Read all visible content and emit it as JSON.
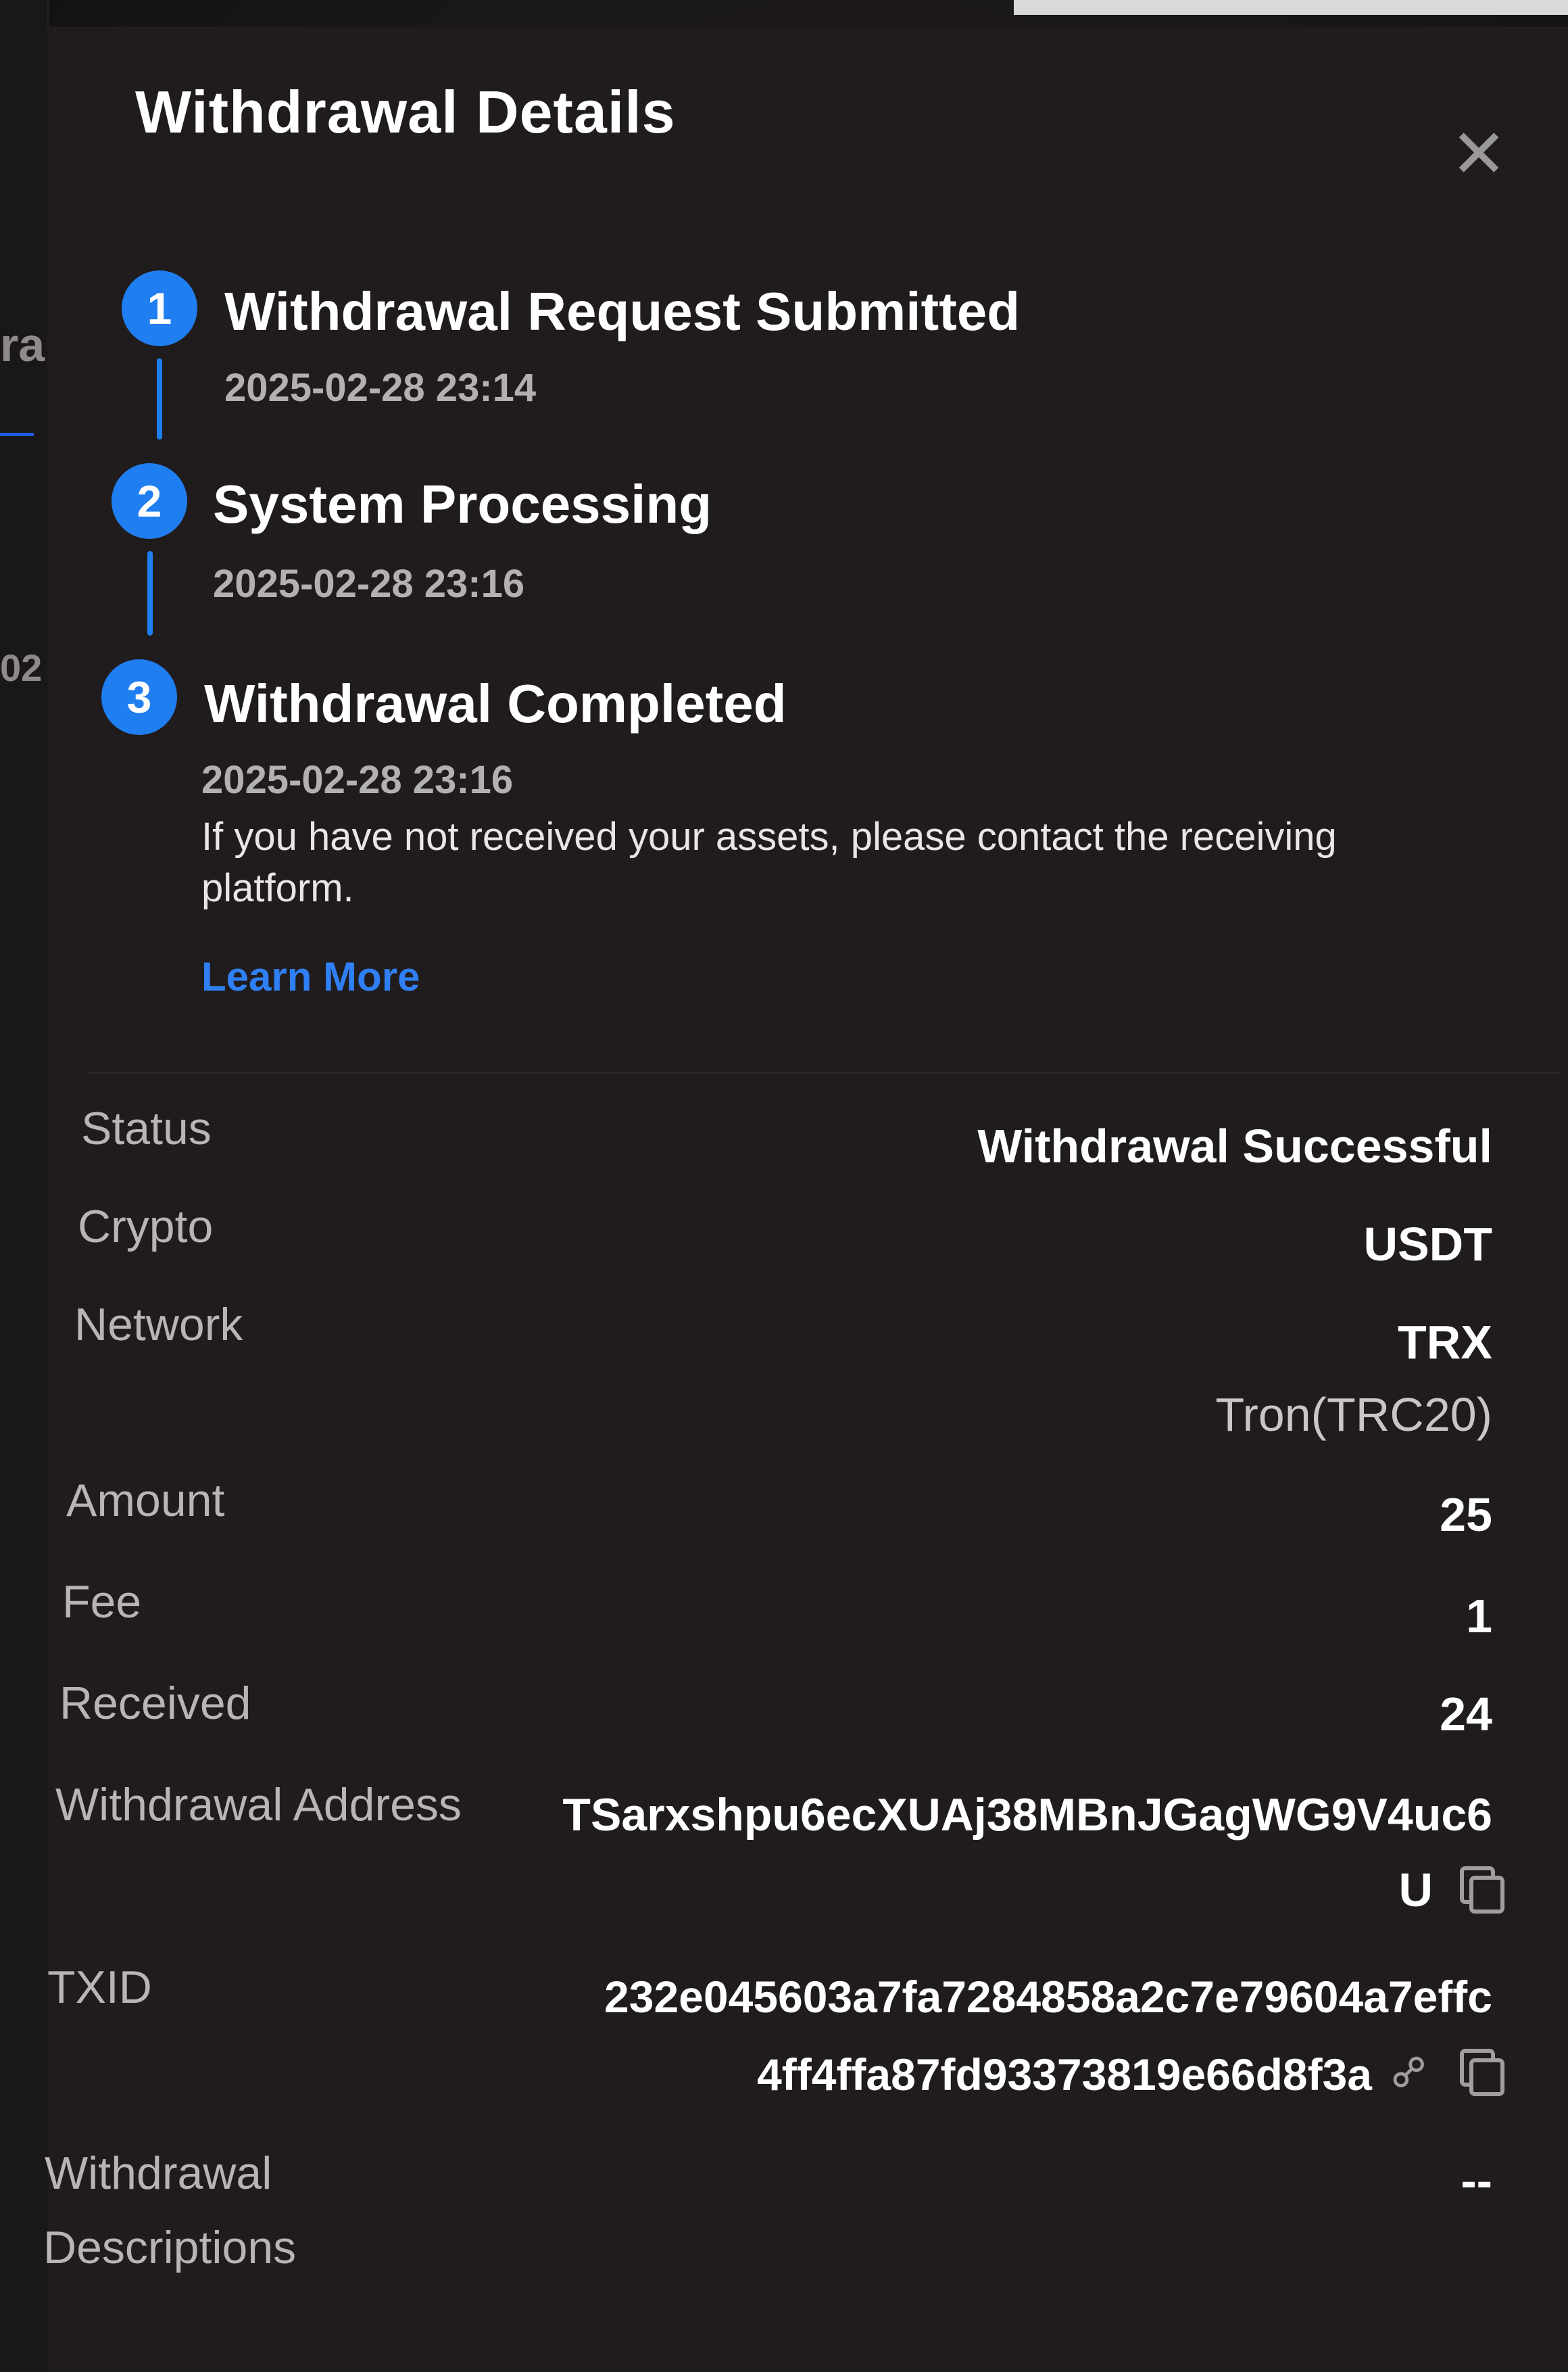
{
  "background": {
    "fragment_top": "ra",
    "fragment_mid": "02"
  },
  "dialog": {
    "title": "Withdrawal Details",
    "close_icon": "close-icon"
  },
  "steps": [
    {
      "number": "1",
      "title": "Withdrawal Request Submitted",
      "time": "2025-02-28 23:14"
    },
    {
      "number": "2",
      "title": "System Processing",
      "time": "2025-02-28 23:16"
    },
    {
      "number": "3",
      "title": "Withdrawal Completed",
      "time": "2025-02-28 23:16"
    }
  ],
  "note": "If you have not received your assets, please contact the receiving platform.",
  "learn_more": "Learn More",
  "details": {
    "status_label": "Status",
    "status_value": "Withdrawal Successful",
    "crypto_label": "Crypto",
    "crypto_value": "USDT",
    "network_label": "Network",
    "network_value": "TRX",
    "network_sub": "Tron(TRC20)",
    "amount_label": "Amount",
    "amount_value": "25",
    "fee_label": "Fee",
    "fee_value": "1",
    "received_label": "Received",
    "received_value": "24",
    "address_label": "Withdrawal Address",
    "address_line1": "TSarxshpu6ecXUAj38MBnJGagWG9V4uc6",
    "address_line2": "U",
    "txid_label": "TXID",
    "txid_line1": "232e045603a7fa7284858a2c7e79604a7effc",
    "txid_line2": "4ff4ffa87fd93373819e66d8f3a",
    "desc_label_line1": "Withdrawal",
    "desc_label_line2": "Descriptions",
    "desc_value": "--"
  },
  "colors": {
    "accent": "#1f7ef0",
    "link": "#2f7ff5",
    "dialog_bg": "#201c1d"
  }
}
